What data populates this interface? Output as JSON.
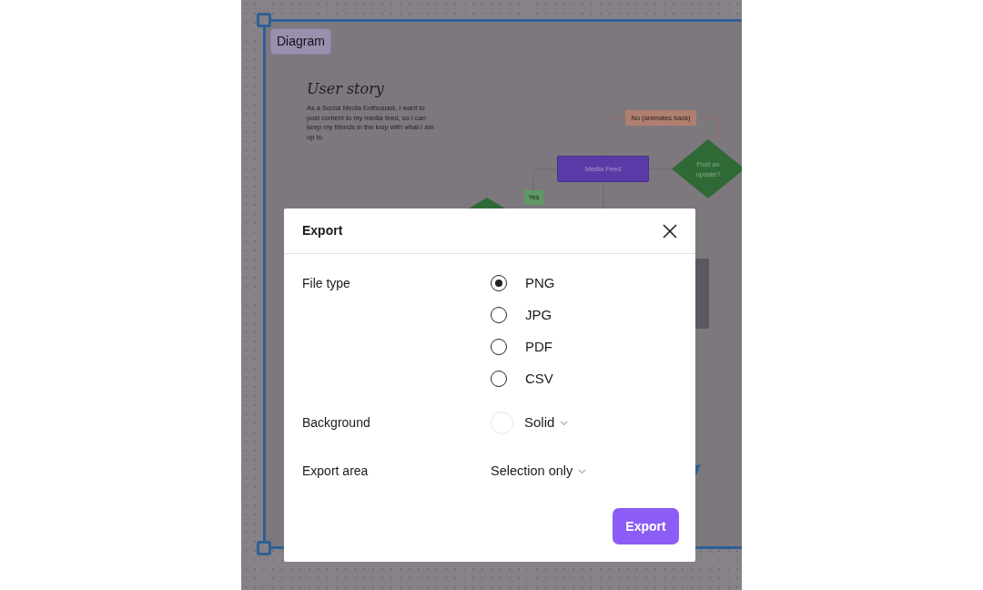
{
  "canvas": {
    "frame_label": "Diagram",
    "user_story": {
      "title": "User story",
      "body": "As a Social Media Enthusiast, I want to post content to my media feed, so I can keep my friends in the loop with what I am up to."
    },
    "nodes": [
      {
        "kind": "process",
        "label": "Media Feed"
      },
      {
        "kind": "decision",
        "label": "Post an update?"
      },
      {
        "kind": "tag",
        "label": "No (animates back)",
        "color": "#b07f6f"
      },
      {
        "kind": "tag",
        "label": "Yes",
        "color": "#5f9a62"
      }
    ]
  },
  "dialog": {
    "title": "Export",
    "file_type": {
      "label": "File type",
      "options": [
        {
          "label": "PNG",
          "selected": true
        },
        {
          "label": "JPG",
          "selected": false
        },
        {
          "label": "PDF",
          "selected": false
        },
        {
          "label": "CSV",
          "selected": false
        }
      ]
    },
    "background": {
      "label": "Background",
      "value": "Solid"
    },
    "export_area": {
      "label": "Export area",
      "value": "Selection only"
    },
    "button": "Export"
  }
}
